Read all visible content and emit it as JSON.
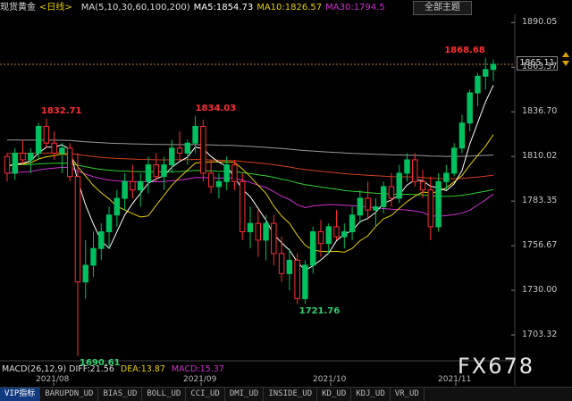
{
  "header": {
    "instrument": "现货黄金",
    "period": "<日线>",
    "ma_params": "MA(5,10,30,60,100,200)",
    "ma5": "MA5:1854.73",
    "ma10": "MA10:1826.57",
    "ma30": "MA30:1794.5",
    "theme_button": "全部主题"
  },
  "price_axis": {
    "ticks": [
      "1890.05",
      "1863.37",
      "1836.70",
      "1810.02",
      "1783.35",
      "1756.67",
      "1730.00",
      "1703.32"
    ],
    "last_price": "1865.11"
  },
  "annotations": {
    "high_1": "1832.71",
    "high_2": "1834.03",
    "low_1": "1690.61",
    "low_2": "1721.76",
    "high_3": "1868.68"
  },
  "dates": [
    "2021/08",
    "2021/09",
    "2021/10",
    "2021/11"
  ],
  "macd": {
    "params": "MACD(26,12,9)",
    "diff": "DIFF:21.56",
    "dea": "DEA:13.87",
    "macd": "MACD:15.37"
  },
  "tabs": [
    "VIP指标",
    "BARUPDN_UD",
    "BIAS_UD",
    "BOLL_UD",
    "CCI_UD",
    "DMI_UD",
    "INSIDE_UD",
    "KD_UD",
    "KDJ_UD",
    "VR_UD"
  ],
  "watermark": "FX678",
  "colors": {
    "up": "#00c060",
    "down": "#ff3030",
    "ma5": "#ffffff",
    "ma10": "#e6d000",
    "ma30": "#d030d0",
    "ma60": "#30d030",
    "ma100": "#d04020",
    "ma200": "#9a9a9a"
  },
  "chart_data": {
    "type": "candlestick",
    "candles": [
      [
        1810,
        1812,
        1795,
        1800
      ],
      [
        1800,
        1815,
        1796,
        1812
      ],
      [
        1812,
        1820,
        1805,
        1808
      ],
      [
        1808,
        1815,
        1800,
        1812
      ],
      [
        1812,
        1830,
        1808,
        1828
      ],
      [
        1828,
        1832.71,
        1815,
        1818
      ],
      [
        1818,
        1825,
        1808,
        1812
      ],
      [
        1812,
        1818,
        1800,
        1815
      ],
      [
        1815,
        1818,
        1795,
        1798
      ],
      [
        1798,
        1812,
        1690.61,
        1735
      ],
      [
        1735,
        1760,
        1725,
        1745
      ],
      [
        1745,
        1765,
        1738,
        1755
      ],
      [
        1755,
        1770,
        1748,
        1765
      ],
      [
        1765,
        1780,
        1755,
        1775
      ],
      [
        1775,
        1790,
        1768,
        1785
      ],
      [
        1785,
        1800,
        1778,
        1795
      ],
      [
        1795,
        1805,
        1785,
        1790
      ],
      [
        1790,
        1800,
        1780,
        1795
      ],
      [
        1795,
        1810,
        1788,
        1805
      ],
      [
        1805,
        1812,
        1795,
        1798
      ],
      [
        1798,
        1810,
        1790,
        1805
      ],
      [
        1805,
        1820,
        1800,
        1815
      ],
      [
        1815,
        1825,
        1808,
        1812
      ],
      [
        1812,
        1820,
        1805,
        1818
      ],
      [
        1818,
        1834.03,
        1812,
        1828
      ],
      [
        1828,
        1832,
        1795,
        1800
      ],
      [
        1800,
        1808,
        1788,
        1792
      ],
      [
        1792,
        1800,
        1785,
        1795
      ],
      [
        1795,
        1810,
        1790,
        1805
      ],
      [
        1805,
        1808,
        1790,
        1795
      ],
      [
        1795,
        1800,
        1760,
        1765
      ],
      [
        1765,
        1780,
        1755,
        1770
      ],
      [
        1770,
        1778,
        1750,
        1760
      ],
      [
        1760,
        1775,
        1748,
        1770
      ],
      [
        1770,
        1775,
        1745,
        1752
      ],
      [
        1752,
        1762,
        1735,
        1740
      ],
      [
        1740,
        1755,
        1730,
        1748
      ],
      [
        1748,
        1752,
        1721.76,
        1725
      ],
      [
        1725,
        1748,
        1722,
        1745
      ],
      [
        1745,
        1768,
        1740,
        1765
      ],
      [
        1765,
        1772,
        1750,
        1758
      ],
      [
        1758,
        1770,
        1752,
        1768
      ],
      [
        1768,
        1778,
        1760,
        1762
      ],
      [
        1762,
        1770,
        1755,
        1765
      ],
      [
        1765,
        1780,
        1760,
        1775
      ],
      [
        1775,
        1790,
        1770,
        1785
      ],
      [
        1785,
        1795,
        1772,
        1778
      ],
      [
        1778,
        1785,
        1768,
        1780
      ],
      [
        1780,
        1795,
        1776,
        1792
      ],
      [
        1792,
        1800,
        1780,
        1785
      ],
      [
        1785,
        1805,
        1782,
        1800
      ],
      [
        1800,
        1812,
        1795,
        1808
      ],
      [
        1808,
        1812,
        1792,
        1795
      ],
      [
        1795,
        1802,
        1785,
        1790
      ],
      [
        1790,
        1798,
        1760,
        1768
      ],
      [
        1768,
        1800,
        1765,
        1795
      ],
      [
        1795,
        1805,
        1790,
        1800
      ],
      [
        1800,
        1818,
        1798,
        1815
      ],
      [
        1815,
        1835,
        1812,
        1830
      ],
      [
        1830,
        1850,
        1825,
        1848
      ],
      [
        1848,
        1860,
        1840,
        1858
      ],
      [
        1858,
        1868.68,
        1850,
        1862
      ],
      [
        1862,
        1868,
        1855,
        1865.11
      ]
    ],
    "ylim": [
      1690,
      1895
    ]
  }
}
